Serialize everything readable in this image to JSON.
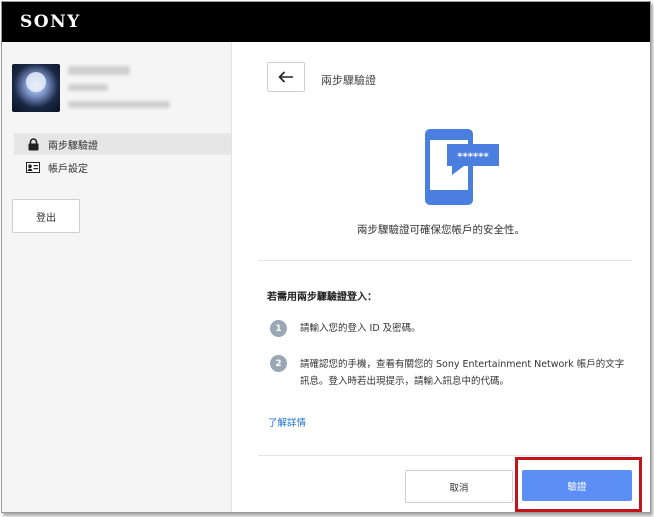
{
  "header": {
    "brand": "SONY"
  },
  "sidebar": {
    "items": [
      {
        "label": "兩步驟驗證",
        "icon": "lock-icon",
        "active": true
      },
      {
        "label": "帳戶設定",
        "icon": "id-card-icon",
        "active": false
      }
    ],
    "logout_label": "登出"
  },
  "main": {
    "title": "兩步驟驗證",
    "description": "兩步驟驗證可確保您帳戶的安全性。",
    "section_title": "若需用兩步驟驗證登入：",
    "steps": [
      {
        "number": "1",
        "text": "請輸入您的登入 ID 及密碼。"
      },
      {
        "number": "2",
        "text": "請確認您的手機，查看有關您的 Sony Entertainment Network 帳戶的文字訊息。登入時若出現提示，請輸入訊息中的代碼。"
      }
    ],
    "learn_more": "了解詳情",
    "phone_code": "******",
    "cancel_label": "取消",
    "verify_label": "驗證"
  },
  "colors": {
    "accent": "#5c8ff5",
    "phone_blue": "#4a7fe0",
    "highlight": "#c3141c",
    "link": "#1a6fd0"
  }
}
